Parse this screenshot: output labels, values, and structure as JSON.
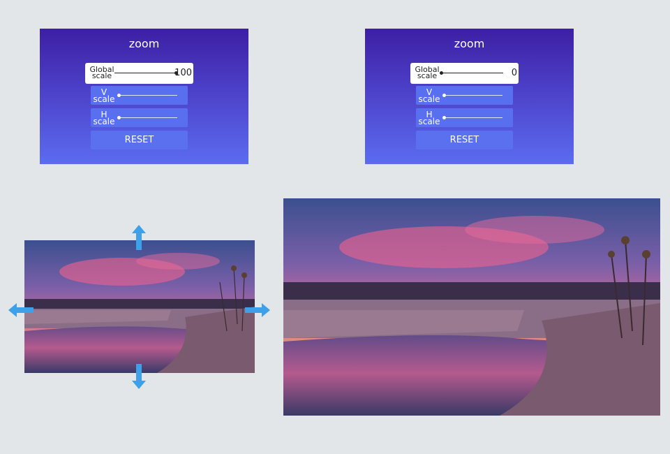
{
  "colors": {
    "background": "#e2e6e9",
    "panel_gradient": [
      "#3d1fa3",
      "#5b6cf0"
    ],
    "accent_arrow": "#3ea0e8"
  },
  "panels": [
    {
      "title": "zoom",
      "global": {
        "label_line1": "Global",
        "label_line2": "scale",
        "value": "100"
      },
      "v_scale": {
        "label_line1": "V",
        "label_line2": "scale",
        "level": 0
      },
      "h_scale": {
        "label_line1": "H",
        "label_line2": "scale",
        "level": 0
      },
      "reset_label": "RESET",
      "global_level": 1.0
    },
    {
      "title": "zoom",
      "global": {
        "label_line1": "Global",
        "label_line2": "scale",
        "value": "0"
      },
      "v_scale": {
        "label_line1": "V",
        "label_line2": "scale",
        "level": 0
      },
      "h_scale": {
        "label_line1": "H",
        "label_line2": "scale",
        "level": 0
      },
      "reset_label": "RESET",
      "global_level": 0.0
    }
  ],
  "arrows": [
    "arrow-up-icon",
    "arrow-down-icon",
    "arrow-left-icon",
    "arrow-right-icon"
  ]
}
